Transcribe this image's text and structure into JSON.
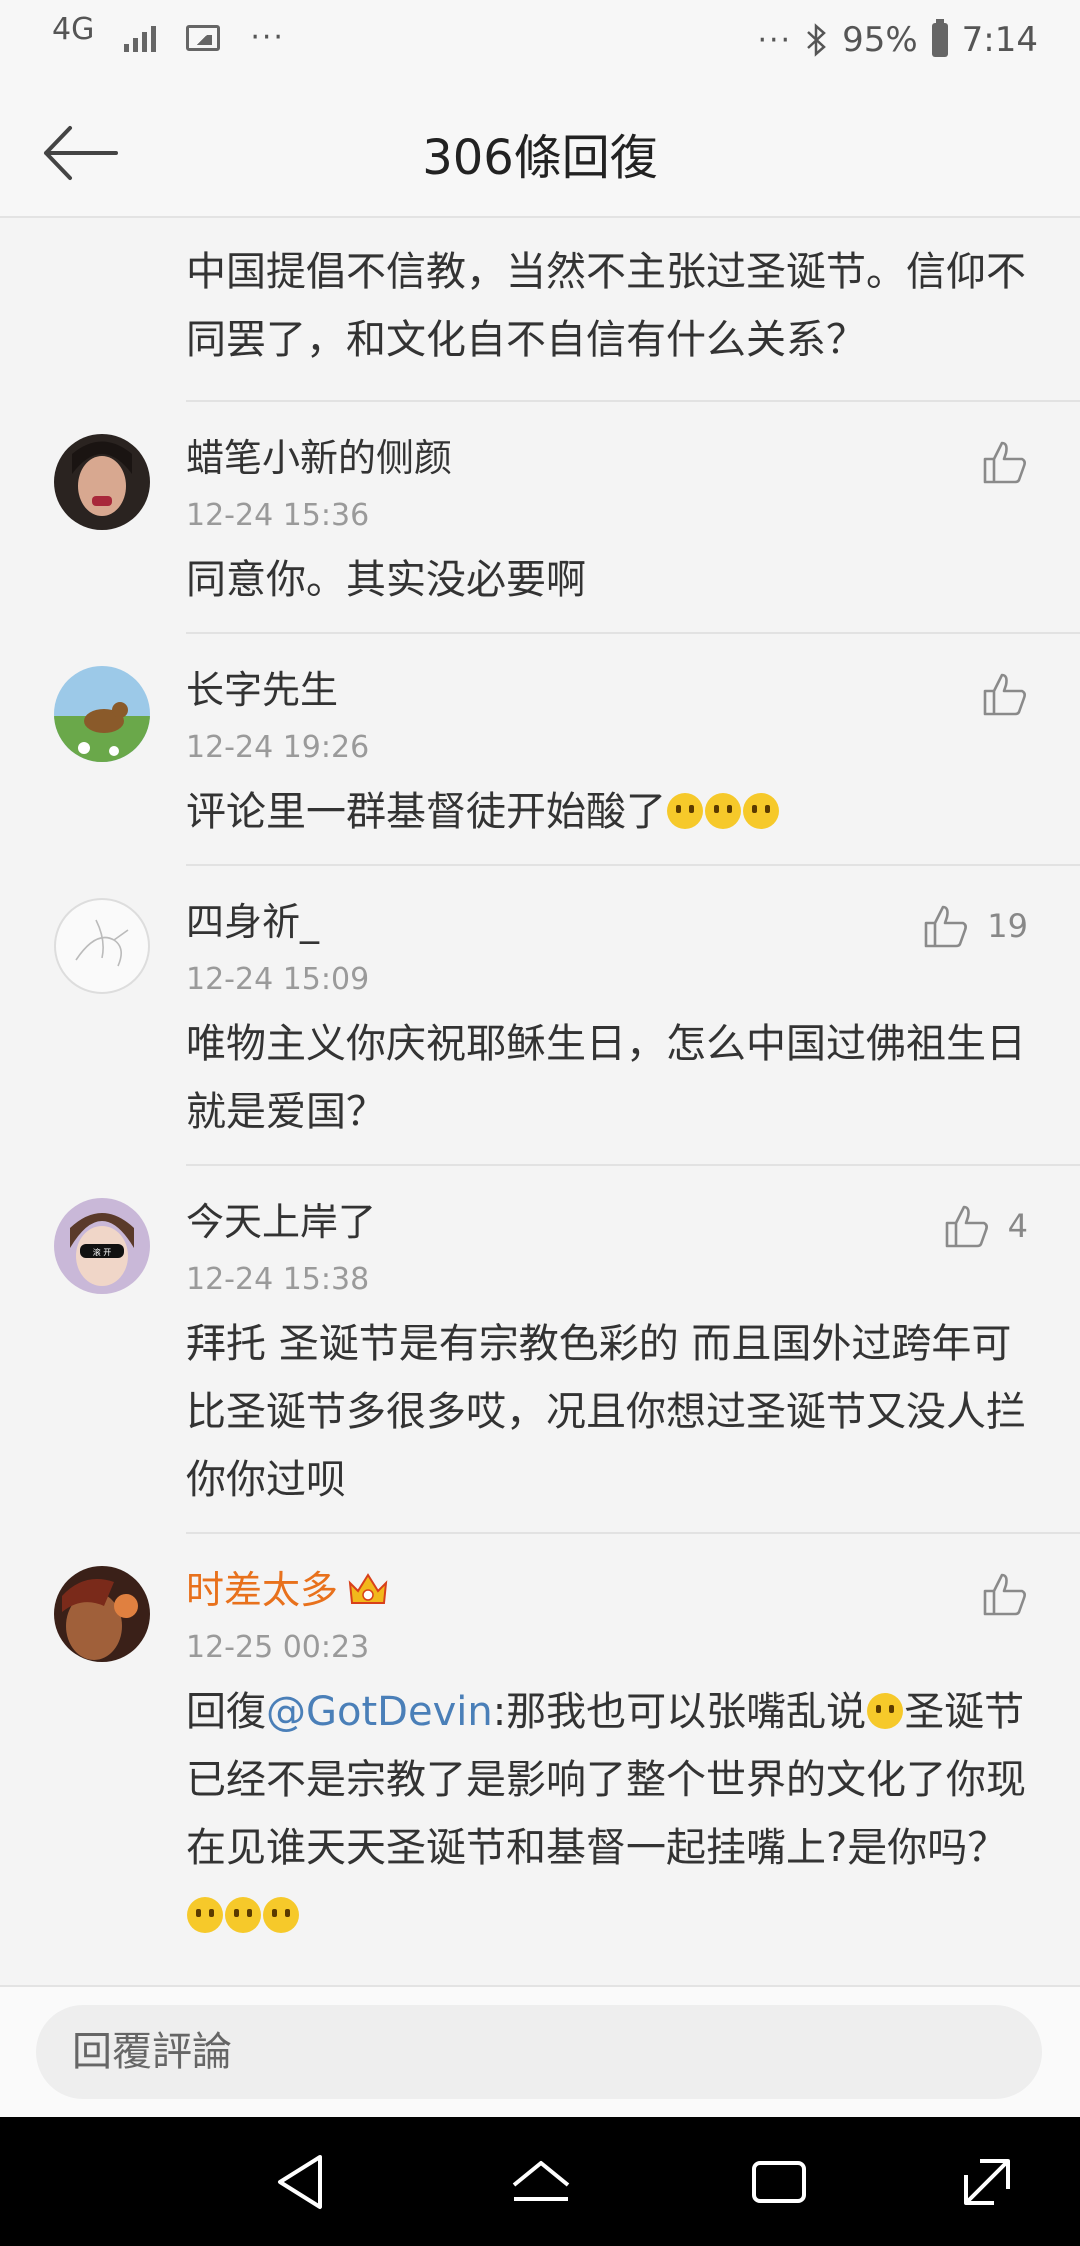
{
  "status_bar": {
    "network": "4G",
    "overflow": "···",
    "overflow_right": "···",
    "battery": "95%",
    "time": "7:14"
  },
  "header": {
    "title": "306條回復"
  },
  "top_comment": {
    "text": "中国提倡不信教，当然不主张过圣诞节。信仰不同罢了，和文化自不自信有什么关系？"
  },
  "comments": [
    {
      "name": "蜡笔小新的侧颜",
      "time": "12-24 15:36",
      "text": "同意你。其实没必要啊",
      "likes": ""
    },
    {
      "name": "长字先生",
      "time": "12-24 19:26",
      "text": "评论里一群基督徒开始酸了",
      "likes": ""
    },
    {
      "name": "四身祈_",
      "time": "12-24 15:09",
      "text": "唯物主义你庆祝耶稣生日，怎么中国过佛祖生日就是爱国？",
      "likes": "19"
    },
    {
      "name": "今天上岸了",
      "time": "12-24 15:38",
      "text": "拜托 圣诞节是有宗教色彩的 而且国外过跨年可比圣诞节多很多哎，况且你想过圣诞节又没人拦你你过呗",
      "likes": "4"
    },
    {
      "name": "时差太多",
      "time": "12-25 00:23",
      "reply_prefix": "回復",
      "mention": "@GotDevin",
      "text_a": ":那我也可以张嘴乱说",
      "text_b": "圣诞节已经不是宗教了是影响了整个世界的文化了你现在见谁天天圣诞节和基督一起挂嘴上?是你吗？",
      "likes": ""
    }
  ],
  "reply_bar": {
    "placeholder": "回覆評論"
  },
  "icons": {
    "back": "arrow-left-icon",
    "like": "thumbs-up-icon",
    "bluetooth": "bluetooth-icon",
    "battery": "battery-icon",
    "image": "image-icon",
    "signal": "signal-icon",
    "nav_back": "triangle-back-icon",
    "nav_home": "home-icon",
    "nav_recents": "recents-icon",
    "nav_expand": "expand-icon",
    "vip": "crown-badge-icon"
  },
  "colors": {
    "vip_name": "#e8711c",
    "mention": "#4a7fb8",
    "time": "#9a9a9a"
  }
}
